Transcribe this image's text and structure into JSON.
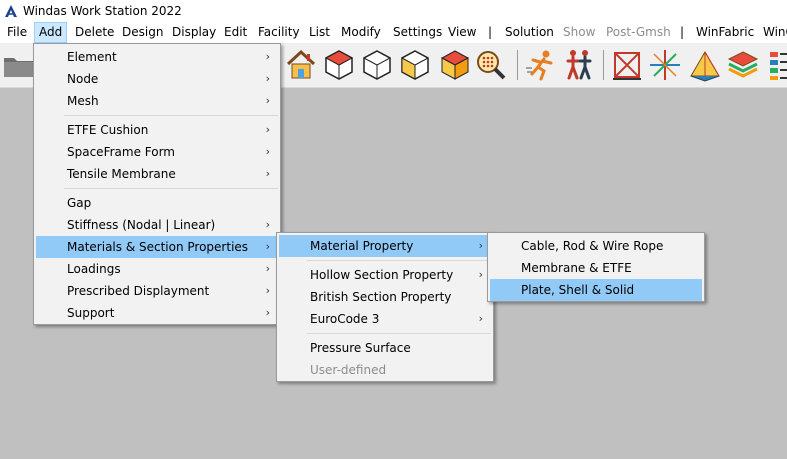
{
  "window": {
    "title": "Windas Work Station 2022"
  },
  "menubar": [
    {
      "label": "File"
    },
    {
      "label": "Add",
      "active": true
    },
    {
      "label": "Delete"
    },
    {
      "label": "Design"
    },
    {
      "label": "Display"
    },
    {
      "label": "Edit"
    },
    {
      "label": "Facility"
    },
    {
      "label": "List"
    },
    {
      "label": "Modify"
    },
    {
      "label": "Settings"
    },
    {
      "label": "View"
    },
    {
      "label": "|"
    },
    {
      "label": "Solution"
    },
    {
      "label": "Show",
      "disabled": true
    },
    {
      "label": "Post-Gmsh",
      "disabled": true
    },
    {
      "label": "|"
    },
    {
      "label": "WinFabric"
    },
    {
      "label": "WinC"
    }
  ],
  "add_menu": [
    {
      "label": "Element",
      "submenu": true
    },
    {
      "label": "Node",
      "submenu": true
    },
    {
      "label": "Mesh",
      "submenu": true
    },
    {
      "separator": true
    },
    {
      "label": "ETFE Cushion",
      "submenu": true
    },
    {
      "label": "SpaceFrame Form",
      "submenu": true
    },
    {
      "label": "Tensile Membrane",
      "submenu": true
    },
    {
      "separator": true
    },
    {
      "label": "Gap",
      "submenu": false
    },
    {
      "label": "Stiffness (Nodal | Linear)",
      "submenu": true
    },
    {
      "label": "Materials & Section Properties",
      "submenu": true,
      "highlighted": true
    },
    {
      "label": "Loadings",
      "submenu": true
    },
    {
      "label": "Prescribed Displayment",
      "submenu": true
    },
    {
      "label": "Support",
      "submenu": true
    }
  ],
  "materials_menu": [
    {
      "label": "Material Property",
      "submenu": true,
      "highlighted": true
    },
    {
      "separator": true
    },
    {
      "label": "Hollow Section Property",
      "submenu": true
    },
    {
      "label": "British Section Property",
      "submenu": false
    },
    {
      "label": "EuroCode 3",
      "submenu": true
    },
    {
      "separator": true
    },
    {
      "label": "Pressure Surface",
      "submenu": false
    },
    {
      "label": "User-defined",
      "submenu": false,
      "disabled": true
    }
  ],
  "material_property_menu": [
    {
      "label": "Cable, Rod & Wire Rope"
    },
    {
      "label": "Membrane & ETFE"
    },
    {
      "label": "Plate, Shell & Solid",
      "highlighted": true
    }
  ],
  "toolbar_icons": [
    "folder-icon",
    "home-icon",
    "cube-red-icon",
    "cube-white-icon",
    "cube-yellow-icon",
    "cube-color-icon",
    "zoom-grid-icon",
    "runner-icon",
    "walkers-icon",
    "cross-frame-icon",
    "axes-icon",
    "pyramid-icon",
    "layers-icon",
    "list-icon"
  ],
  "colors": {
    "highlight": "#91c9f7",
    "menu_bg": "#f2f2f2",
    "workspace": "#c0c0c0"
  }
}
